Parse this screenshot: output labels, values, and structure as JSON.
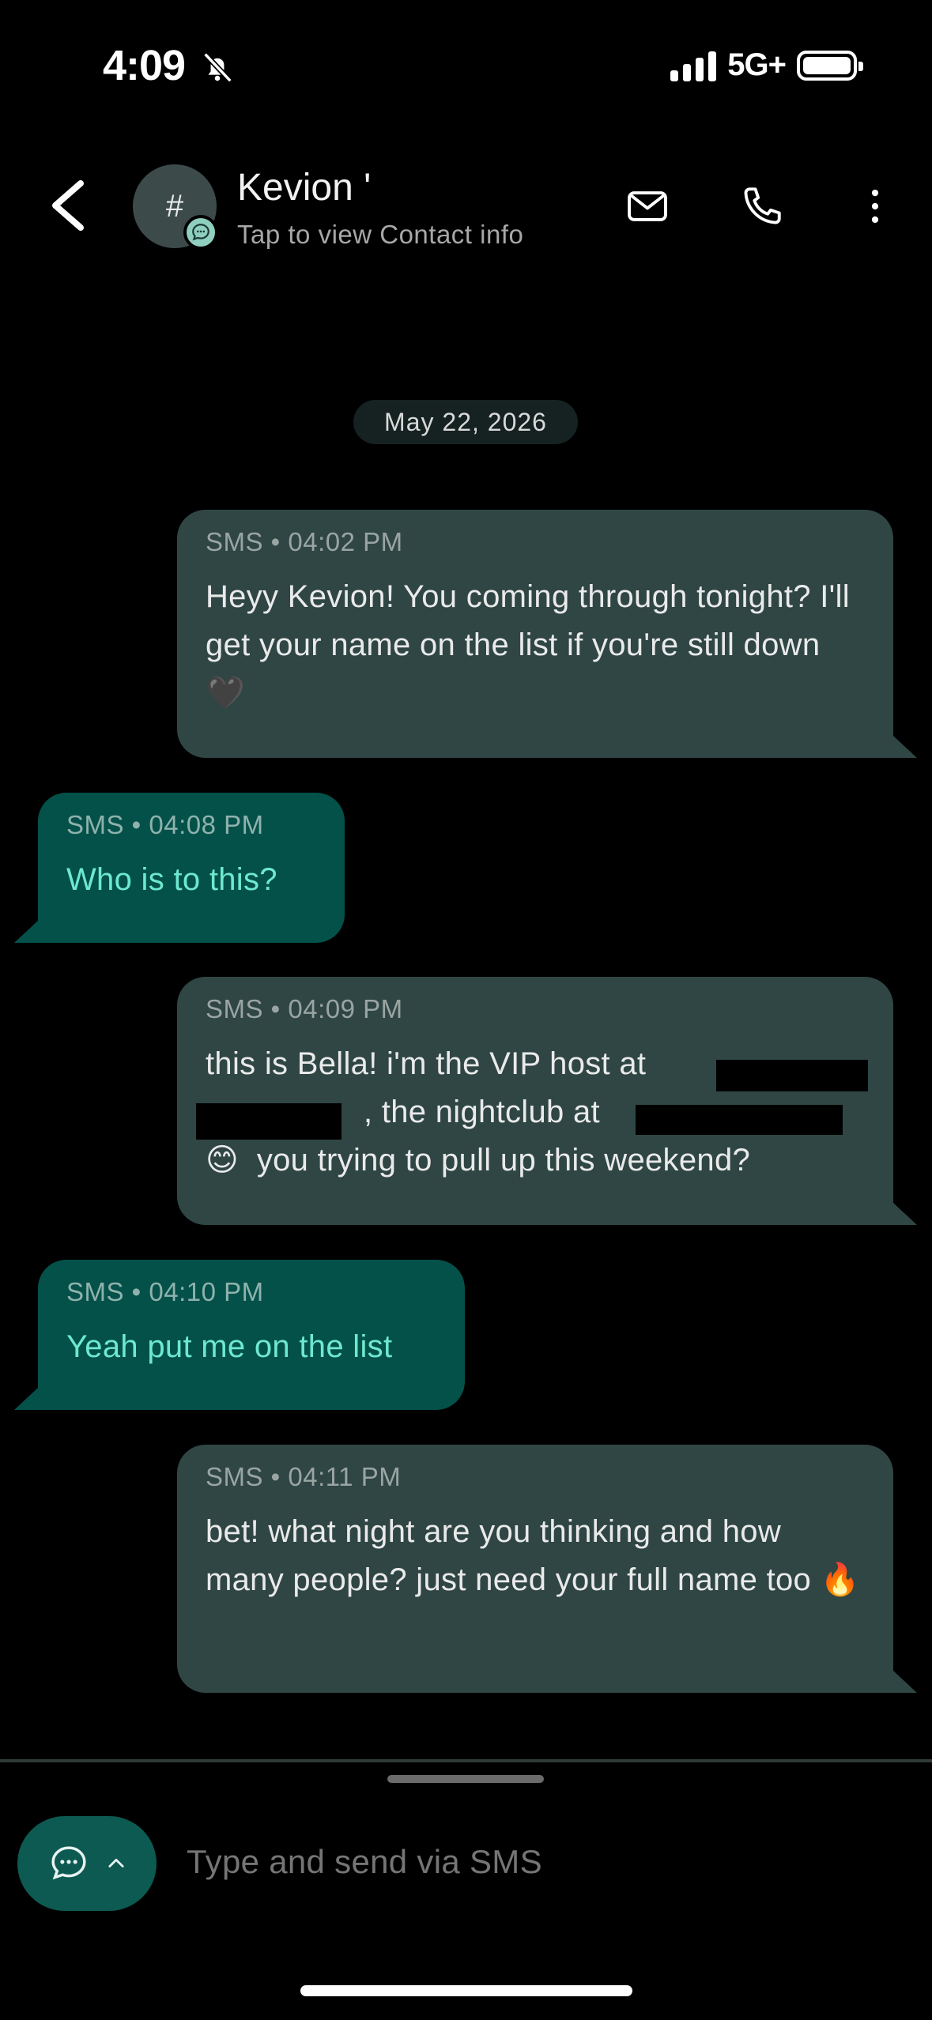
{
  "status_bar": {
    "time": "4:09",
    "network": "5G+"
  },
  "header": {
    "contact_name": "Kevion '",
    "contact_sub": "Tap to view Contact info",
    "avatar_char": "#"
  },
  "date_chip": "May 22, 2026",
  "messages": [
    {
      "direction": "incoming",
      "meta": "SMS • 04:02 PM",
      "text": "Heyy Kevion! You coming through tonight? I'll get your name on the list if you're still down 🖤"
    },
    {
      "direction": "outgoing",
      "meta": "SMS • 04:08 PM",
      "text": "Who is to this?"
    },
    {
      "direction": "incoming",
      "meta": "SMS • 04:09 PM",
      "text": "this is Bella! i'm the VIP host at , the nightclub at 😊 you trying to pull up this weekend?"
    },
    {
      "direction": "outgoing",
      "meta": "SMS • 04:10 PM",
      "text": "Yeah put me on the list"
    },
    {
      "direction": "incoming",
      "meta": "SMS • 04:11 PM",
      "text": "bet! what night are you thinking and how many people? just need your full name too 🔥"
    }
  ],
  "composer": {
    "placeholder": "Type and send via SMS"
  },
  "icons": [
    "muted-bell-icon",
    "signal-icon",
    "battery-icon",
    "back-chevron-icon",
    "chat-badge-icon",
    "mail-icon",
    "phone-icon",
    "more-vertical-icon",
    "chat-bubble-icon",
    "chevron-up-icon"
  ],
  "colors": {
    "incoming_bubble": "#2f4644",
    "outgoing_bubble": "#04514a",
    "outgoing_text": "#6ee9ce",
    "background": "#000000"
  }
}
